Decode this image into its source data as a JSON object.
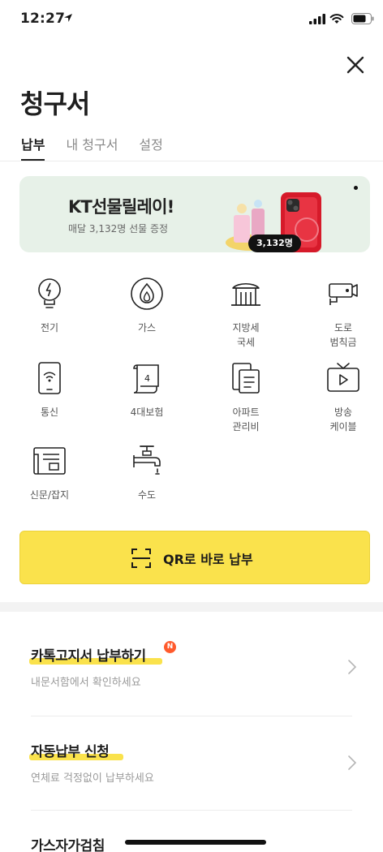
{
  "status_bar": {
    "time": "12:27"
  },
  "header": {
    "title": "청구서"
  },
  "tabs": [
    {
      "label": "납부"
    },
    {
      "label": "내 청구서"
    },
    {
      "label": "설정"
    }
  ],
  "banner": {
    "title": "KT선물릴레이!",
    "subtitle": "매달 3,132명 선물 증정",
    "badge": "3,132명"
  },
  "categories": [
    {
      "label": "전기",
      "icon": "bulb-icon"
    },
    {
      "label": "가스",
      "icon": "flame-icon"
    },
    {
      "label": "지방세\n국세",
      "icon": "government-building-icon"
    },
    {
      "label": "도로\n범칙금",
      "icon": "traffic-camera-icon"
    },
    {
      "label": "통신",
      "icon": "phone-icon"
    },
    {
      "label": "4대보험",
      "icon": "insurance-scroll-icon"
    },
    {
      "label": "아파트\n관리비",
      "icon": "apartment-document-icon"
    },
    {
      "label": "방송\n케이블",
      "icon": "tv-icon"
    },
    {
      "label": "신문/잡지",
      "icon": "newspaper-icon"
    },
    {
      "label": "수도",
      "icon": "water-faucet-icon"
    }
  ],
  "qr_button": {
    "label": "QR로 바로 납부"
  },
  "menu": [
    {
      "title": "카톡고지서 납부하기",
      "subtitle": "내문서함에서 확인하세요",
      "badge": "N"
    },
    {
      "title": "자동납부 신청",
      "subtitle": "연체료 걱정없이 납부하세요"
    },
    {
      "title": "가스자가검침"
    }
  ],
  "colors": {
    "accent_yellow": "#fae24c",
    "banner_bg": "#e7f1e8",
    "new_badge": "#ff5a2c"
  }
}
